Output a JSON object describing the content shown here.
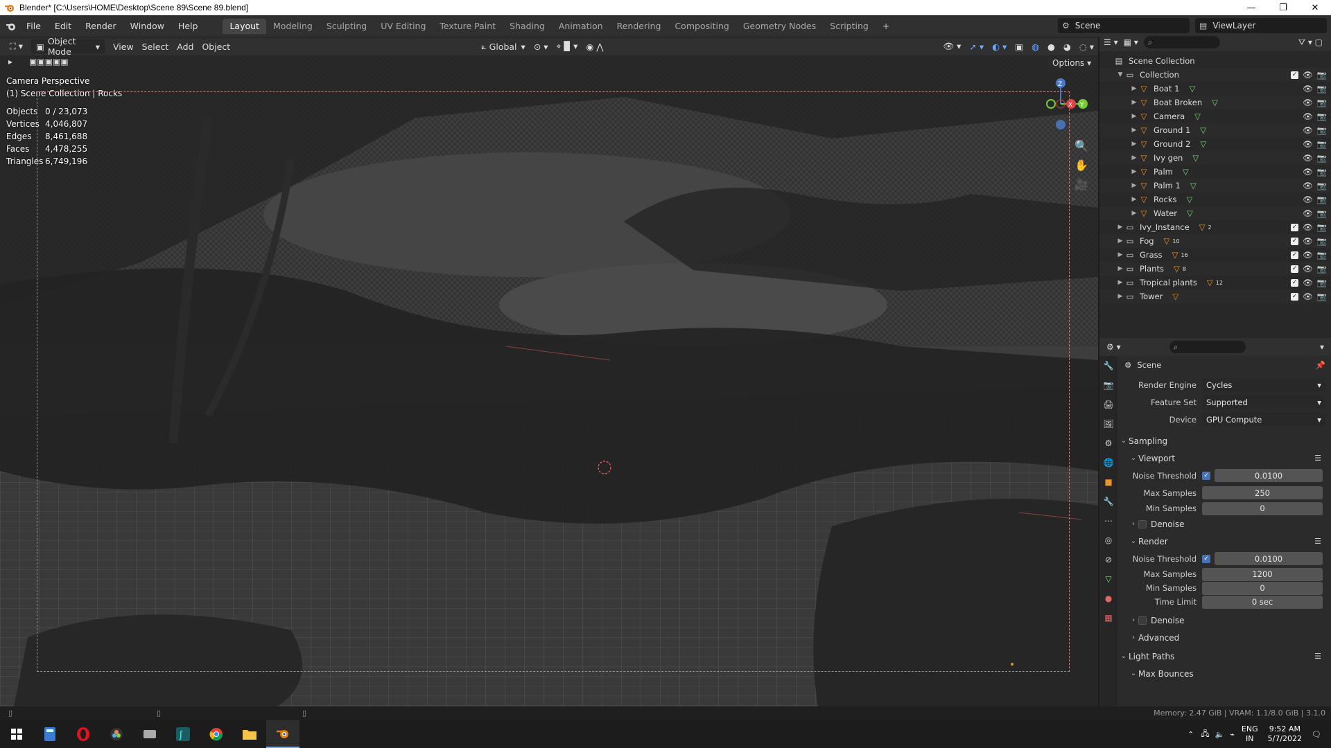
{
  "window": {
    "title": "Blender* [C:\\Users\\HOME\\Desktop\\Scene 89\\Scene 89.blend]",
    "min": "—",
    "max": "❐",
    "close": "✕"
  },
  "menu": [
    "File",
    "Edit",
    "Render",
    "Window",
    "Help"
  ],
  "workspaces": [
    "Layout",
    "Modeling",
    "Sculpting",
    "UV Editing",
    "Texture Paint",
    "Shading",
    "Animation",
    "Rendering",
    "Compositing",
    "Geometry Nodes",
    "Scripting",
    "+"
  ],
  "scene": {
    "name": "Scene",
    "view_layer": "ViewLayer"
  },
  "viewport_header": {
    "mode": "Object Mode",
    "view": "View",
    "select": "Select",
    "add": "Add",
    "object": "Object",
    "orientation": "Global",
    "options": "Options"
  },
  "viewport": {
    "perspective": "Camera Perspective",
    "collection_info": "(1) Scene Collection | Rocks",
    "stats": [
      {
        "label": "Objects",
        "value": "0 / 23,073"
      },
      {
        "label": "Vertices",
        "value": "4,046,807"
      },
      {
        "label": "Edges",
        "value": "8,461,688"
      },
      {
        "label": "Faces",
        "value": "4,478,255"
      },
      {
        "label": "Triangles",
        "value": "6,749,196"
      }
    ],
    "gizmo": {
      "z": "Z",
      "x": "X",
      "y": "Y"
    }
  },
  "outliner": {
    "root": "Scene Collection",
    "collection": "Collection",
    "items": [
      {
        "name": "Boat 1",
        "count": ""
      },
      {
        "name": "Boat Broken",
        "count": ""
      },
      {
        "name": "Camera",
        "count": ""
      },
      {
        "name": "Ground 1",
        "count": ""
      },
      {
        "name": "Ground 2",
        "count": ""
      },
      {
        "name": "Ivy gen",
        "count": ""
      },
      {
        "name": "Palm",
        "count": ""
      },
      {
        "name": "Palm 1",
        "count": ""
      },
      {
        "name": "Rocks",
        "count": ""
      },
      {
        "name": "Water",
        "count": ""
      }
    ],
    "collections": [
      {
        "name": "Ivy_Instance",
        "count": "2"
      },
      {
        "name": "Fog",
        "count": "10"
      },
      {
        "name": "Grass",
        "count": "16"
      },
      {
        "name": "Plants",
        "count": "8"
      },
      {
        "name": "Tropical plants",
        "count": "12"
      },
      {
        "name": "Tower",
        "count": ""
      }
    ]
  },
  "properties": {
    "title": "Scene",
    "render_engine": {
      "label": "Render Engine",
      "value": "Cycles"
    },
    "feature_set": {
      "label": "Feature Set",
      "value": "Supported"
    },
    "device": {
      "label": "Device",
      "value": "GPU Compute"
    },
    "sampling": "Sampling",
    "viewport_sec": "Viewport",
    "vp_noise": {
      "label": "Noise Threshold",
      "value": "0.0100"
    },
    "vp_max": {
      "label": "Max Samples",
      "value": "250"
    },
    "vp_min": {
      "label": "Min Samples",
      "value": "0"
    },
    "denoise": "Denoise",
    "render_sec": "Render",
    "r_noise": {
      "label": "Noise Threshold",
      "value": "0.0100"
    },
    "r_max": {
      "label": "Max Samples",
      "value": "1200"
    },
    "r_min": {
      "label": "Min Samples",
      "value": "0"
    },
    "r_time": {
      "label": "Time Limit",
      "value": "0 sec"
    },
    "denoise2": "Denoise",
    "advanced": "Advanced",
    "light_paths": "Light Paths",
    "max_bounces": "Max Bounces"
  },
  "status": {
    "memory": "Memory: 2.47 GiB | VRAM: 1.1/8.0 GiB | 3.1.0"
  },
  "taskbar": {
    "lang1": "ENG",
    "lang2": "IN",
    "time": "9:52 AM",
    "date": "5/7/2022"
  },
  "colors": {
    "accent": "#4772b3",
    "object_orange": "#e8952e",
    "mesh_green": "#7fd17f"
  }
}
